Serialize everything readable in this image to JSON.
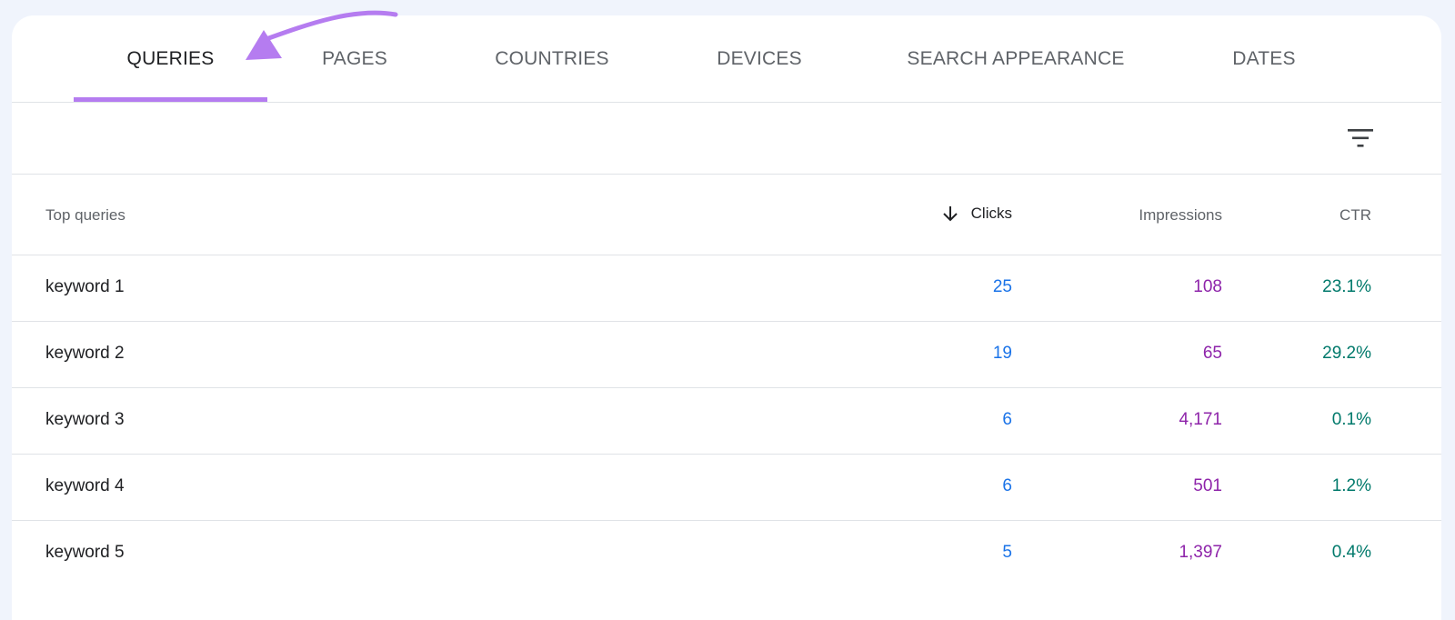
{
  "tabs": {
    "queries": "QUERIES",
    "pages": "PAGES",
    "countries": "COUNTRIES",
    "devices": "DEVICES",
    "search_appearance": "SEARCH APPEARANCE",
    "dates": "DATES",
    "active": "QUERIES"
  },
  "filter": {
    "icon": "filter-icon"
  },
  "table": {
    "headers": {
      "query": "Top queries",
      "clicks": "Clicks",
      "impressions": "Impressions",
      "ctr": "CTR"
    },
    "sort_icon": "arrow-down-icon",
    "rows": [
      {
        "query": "keyword 1",
        "clicks": "25",
        "impressions": "108",
        "ctr": "23.1%"
      },
      {
        "query": "keyword 2",
        "clicks": "19",
        "impressions": "65",
        "ctr": "29.2%"
      },
      {
        "query": "keyword 3",
        "clicks": "6",
        "impressions": "4,171",
        "ctr": "0.1%"
      },
      {
        "query": "keyword 4",
        "clicks": "6",
        "impressions": "501",
        "ctr": "1.2%"
      },
      {
        "query": "keyword 5",
        "clicks": "5",
        "impressions": "1,397",
        "ctr": "0.4%"
      }
    ]
  },
  "colors": {
    "accent": "#b57cf0",
    "clicks": "#1a73e8",
    "impressions": "#8e24aa",
    "ctr": "#00796b",
    "annotation_arrow": "#b57cf0"
  }
}
